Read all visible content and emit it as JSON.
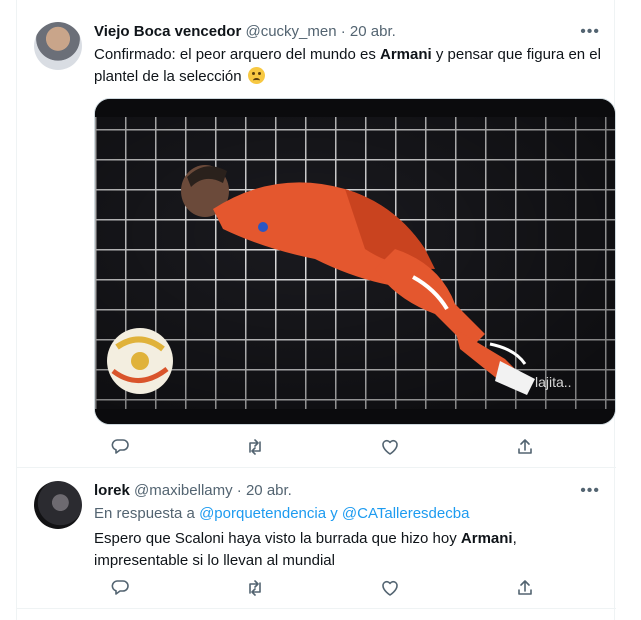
{
  "tweets": [
    {
      "author_name": "Viejo Boca vencedor",
      "handle": "@cucky_men",
      "separator": "·",
      "date": "20 abr.",
      "text_part1": "Confirmado: el peor arquero del mundo es ",
      "text_bold": "Armani",
      "text_part2": " y pensar que figura en el plantel de la selección",
      "emoji": "slightly-frowning-face-emoji",
      "media_watermark": "lajita..",
      "more_label": "•••"
    },
    {
      "author_name": "lorek",
      "handle": "@maxibellamy",
      "separator": "·",
      "date": "20 abr.",
      "reply_prefix": "En respuesta a ",
      "reply_user1": "@porquetendencia",
      "reply_conj": " y ",
      "reply_user2": "@CATalleresdecba",
      "text_part1": "Espero que Scaloni haya visto la burrada que hizo hoy ",
      "text_bold": "Armani",
      "text_part2": ", impresentable si lo llevan al mundial",
      "more_label": "•••"
    }
  ],
  "actions": [
    "reply-icon",
    "retweet-icon",
    "like-icon",
    "share-icon"
  ],
  "colors": {
    "accent": "#1d9bf0",
    "meta": "#536471",
    "text": "#0f1419",
    "border": "#eff3f4"
  }
}
